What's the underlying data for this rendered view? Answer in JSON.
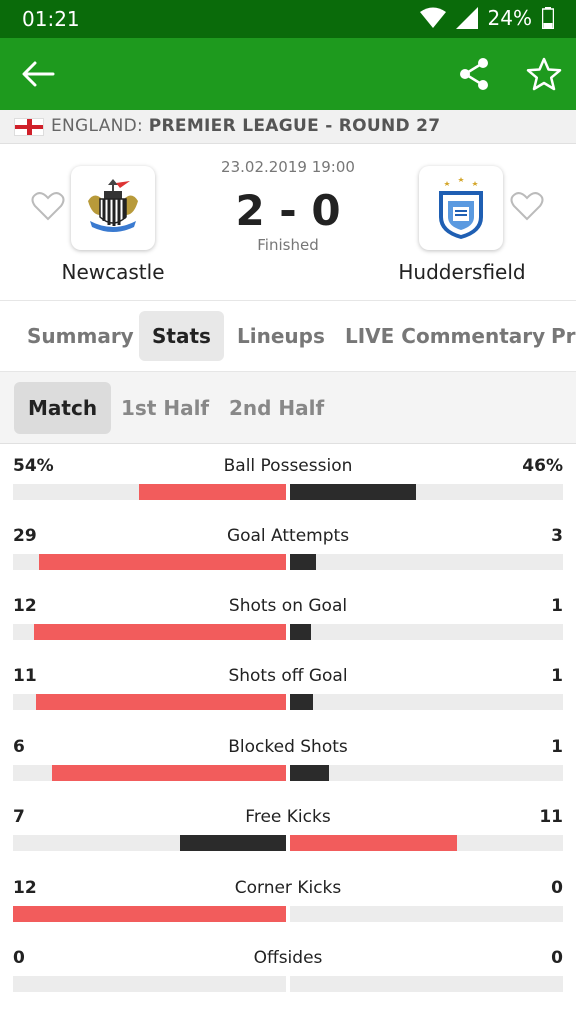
{
  "status_bar": {
    "time": "01:21",
    "battery": "24%"
  },
  "app_bar": {
    "back_icon": "arrow-left-icon",
    "share_icon": "share-icon",
    "favorite_icon": "star-outline-icon"
  },
  "league": {
    "country": "ENGLAND:",
    "competition": "PREMIER LEAGUE - ROUND 27"
  },
  "match": {
    "datetime": "23.02.2019 19:00",
    "score": "2 - 0",
    "status": "Finished",
    "home_team": "Newcastle",
    "away_team": "Huddersfield"
  },
  "tabs": [
    {
      "label": "Summary",
      "active": false
    },
    {
      "label": "Stats",
      "active": true
    },
    {
      "label": "Lineups",
      "active": false
    },
    {
      "label": "LIVE Commentary",
      "active": false
    },
    {
      "label": "Pr",
      "active": false
    }
  ],
  "subtabs": [
    {
      "label": "Match",
      "active": true
    },
    {
      "label": "1st Half",
      "active": false
    },
    {
      "label": "2nd Half",
      "active": false
    }
  ],
  "colors": {
    "leader": "#f25c5c",
    "trailer": "#2b2b2b",
    "track": "#ececec",
    "appbar": "#1e9a1e",
    "statusbar": "#0a6b0a"
  },
  "stats": [
    {
      "name": "Ball Possession",
      "home": "54%",
      "away": "46%",
      "home_share": 0.54,
      "away_share": 0.46,
      "leader": "home"
    },
    {
      "name": "Goal Attempts",
      "home": "29",
      "away": "3",
      "home_share": 0.906,
      "away_share": 0.094,
      "leader": "home"
    },
    {
      "name": "Shots on Goal",
      "home": "12",
      "away": "1",
      "home_share": 0.923,
      "away_share": 0.077,
      "leader": "home"
    },
    {
      "name": "Shots off Goal",
      "home": "11",
      "away": "1",
      "home_share": 0.917,
      "away_share": 0.083,
      "leader": "home"
    },
    {
      "name": "Blocked Shots",
      "home": "6",
      "away": "1",
      "home_share": 0.857,
      "away_share": 0.143,
      "leader": "home"
    },
    {
      "name": "Free Kicks",
      "home": "7",
      "away": "11",
      "home_share": 0.389,
      "away_share": 0.611,
      "leader": "away"
    },
    {
      "name": "Corner Kicks",
      "home": "12",
      "away": "0",
      "home_share": 1.0,
      "away_share": 0.0,
      "leader": "home"
    },
    {
      "name": "Offsides",
      "home": "0",
      "away": "0",
      "home_share": 0.0,
      "away_share": 0.0,
      "leader": "none"
    }
  ]
}
